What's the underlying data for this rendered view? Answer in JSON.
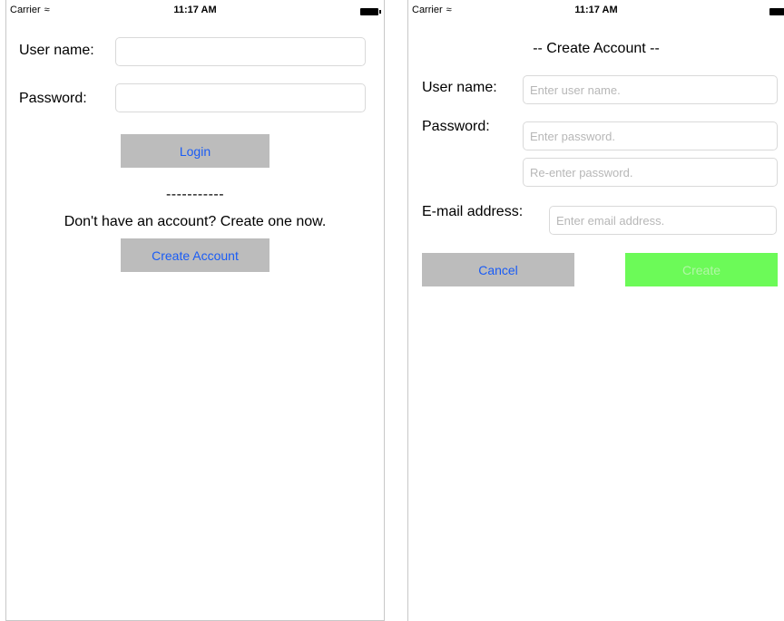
{
  "status_bar": {
    "carrier": "Carrier",
    "time": "11:17 AM",
    "wifi_icon": "wifi-icon",
    "battery_icon": "battery-icon"
  },
  "login_screen": {
    "username_label": "User name:",
    "password_label": "Password:",
    "username_value": "",
    "password_value": "",
    "login_button": "Login",
    "divider": "-----------",
    "prompt": "Don't have an account? Create one now.",
    "create_account_button": "Create Account"
  },
  "create_screen": {
    "title": "-- Create Account --",
    "username_label": "User name:",
    "username_placeholder": "Enter user name.",
    "password_label": "Password:",
    "password_placeholder": "Enter password.",
    "reenter_placeholder": "Re-enter password.",
    "email_label": "E-mail address:",
    "email_placeholder": "Enter email address.",
    "cancel_button": "Cancel",
    "create_button": "Create"
  },
  "colors": {
    "button_gray": "#bcbcbc",
    "link_blue": "#1a5cf5",
    "create_green": "#6cfa58",
    "create_text_disabled": "#b2f6a6"
  }
}
